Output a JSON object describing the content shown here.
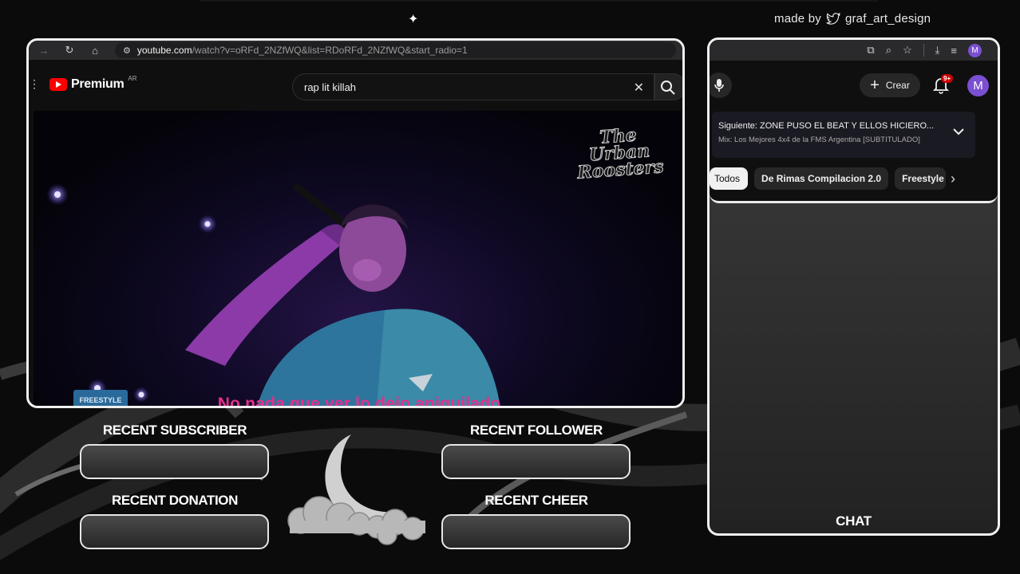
{
  "overlay": {
    "credit_prefix": "made by",
    "credit_handle": "graf_art_design",
    "chat_label": "CHAT",
    "alerts": {
      "recent_subscriber": "RECENT SUBSCRIBER",
      "recent_follower": "RECENT FOLLOWER",
      "recent_donation": "RECENT DONATION",
      "recent_cheer": "RECENT CHEER"
    }
  },
  "left_browser": {
    "url_host": "youtube.com",
    "url_path": "/watch?v=oRFd_2NZfWQ&list=RDoRFd_2NZfWQ&start_radio=1",
    "logo_label": "Premium",
    "region": "AR",
    "search_value": "rap lit killah",
    "watermark": "The Urban Roosters",
    "subtitle": "No nada que ver lo dejo aniquilado",
    "badge": "FREESTYLE"
  },
  "right_browser": {
    "create_label": "Crear",
    "notification_count": "9+",
    "avatar_letter": "M",
    "next_title": "Siguiente: ZONE PUSO EL BEAT Y ELLOS HICIERO...",
    "next_playlist": "Mix: Los Mejores 4x4 de la FMS Argentina [SUBTITULADO]",
    "chips": [
      "Todos",
      "De Rimas Compilacion 2.0",
      "Freestyle I"
    ]
  },
  "colors": {
    "youtube_red": "#ff0000",
    "subtitle_pink": "#e52f8c",
    "avatar_purple": "#7b4fd1",
    "frame_white": "#f0f0f0"
  }
}
